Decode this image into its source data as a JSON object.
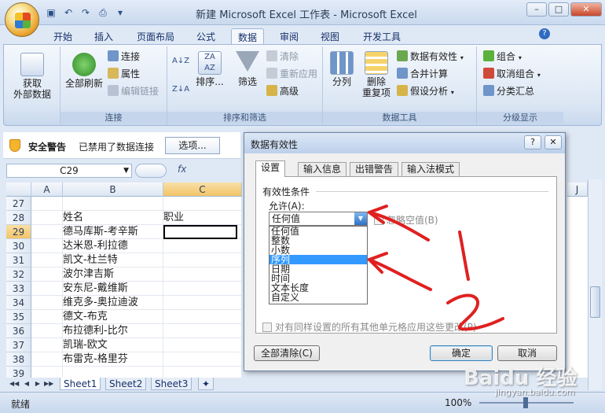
{
  "window": {
    "title": "新建 Microsoft Excel 工作表 - Microsoft Excel"
  },
  "ribbon_tabs": [
    "开始",
    "插入",
    "页面布局",
    "公式",
    "数据",
    "审阅",
    "视图",
    "开发工具"
  ],
  "ribbon": {
    "groups": {
      "connections": "连接",
      "sort_filter": "排序和筛选",
      "data_tools": "数据工具",
      "outline": "分级显示"
    },
    "get_external_data": "获取\n外部数据",
    "refresh_all": "全部刷新",
    "connections": "连接",
    "properties": "属性",
    "edit_links": "编辑链接",
    "sort": "排序...",
    "filter": "筛选",
    "clear": "清除",
    "reapply": "重新应用",
    "advanced": "高级",
    "text_to_columns": "分列",
    "remove_duplicates": "删除\n重复项",
    "data_validation": "数据有效性",
    "consolidate": "合并计算",
    "what_if": "假设分析",
    "group": "组合",
    "ungroup": "取消组合",
    "subtotal": "分类汇总",
    "az": "A↓Z",
    "za": "Z↓A"
  },
  "security": {
    "title": "安全警告",
    "text": "已禁用了数据连接",
    "options_btn": "选项..."
  },
  "formula_bar": {
    "name_box": "C29",
    "fx": "fx"
  },
  "grid": {
    "columns": [
      "A",
      "B",
      "C"
    ],
    "rows": [
      {
        "num": "27",
        "b": "",
        "c": ""
      },
      {
        "num": "28",
        "b": "姓名",
        "c": "职业"
      },
      {
        "num": "29",
        "b": "德马库斯-考辛斯",
        "c": ""
      },
      {
        "num": "30",
        "b": "达米恩-利拉德",
        "c": ""
      },
      {
        "num": "31",
        "b": "凯文-杜兰特",
        "c": ""
      },
      {
        "num": "32",
        "b": "波尔津吉斯",
        "c": ""
      },
      {
        "num": "33",
        "b": "安东尼-戴维斯",
        "c": ""
      },
      {
        "num": "34",
        "b": "维克多-奥拉迪波",
        "c": ""
      },
      {
        "num": "35",
        "b": "德文-布克",
        "c": ""
      },
      {
        "num": "36",
        "b": "布拉德利-比尔",
        "c": ""
      },
      {
        "num": "37",
        "b": "凯瑞-欧文",
        "c": ""
      },
      {
        "num": "38",
        "b": "布雷克-格里芬",
        "c": ""
      },
      {
        "num": "39",
        "b": "",
        "c": ""
      }
    ]
  },
  "right_col": "J",
  "sheets": [
    "Sheet1",
    "Sheet2",
    "Sheet3"
  ],
  "status": {
    "ready": "就绪",
    "zoom": "100%"
  },
  "dialog": {
    "title": "数据有效性",
    "tabs": [
      "设置",
      "输入信息",
      "出错警告",
      "输入法模式"
    ],
    "section": "有效性条件",
    "allow_label": "允许(A):",
    "allow_value": "任何值",
    "ignore_blank": "忽略空值(B)",
    "options": [
      "任何值",
      "整数",
      "小数",
      "序列",
      "日期",
      "时间",
      "文本长度",
      "自定义"
    ],
    "selected_option": "序列",
    "apply_all": "对有同样设置的所有其他单元格应用这些更改(P)",
    "clear_all": "全部清除(C)",
    "ok": "确定",
    "cancel": "取消"
  },
  "annotations": {
    "num1": "1",
    "num2": "2"
  },
  "watermark": {
    "brand": "Baidu 经验",
    "url": "jingyan.baidu.com"
  },
  "colors": {
    "arrow": "#e02020",
    "accent": "#2f72c7",
    "selection": "#3399ff"
  }
}
